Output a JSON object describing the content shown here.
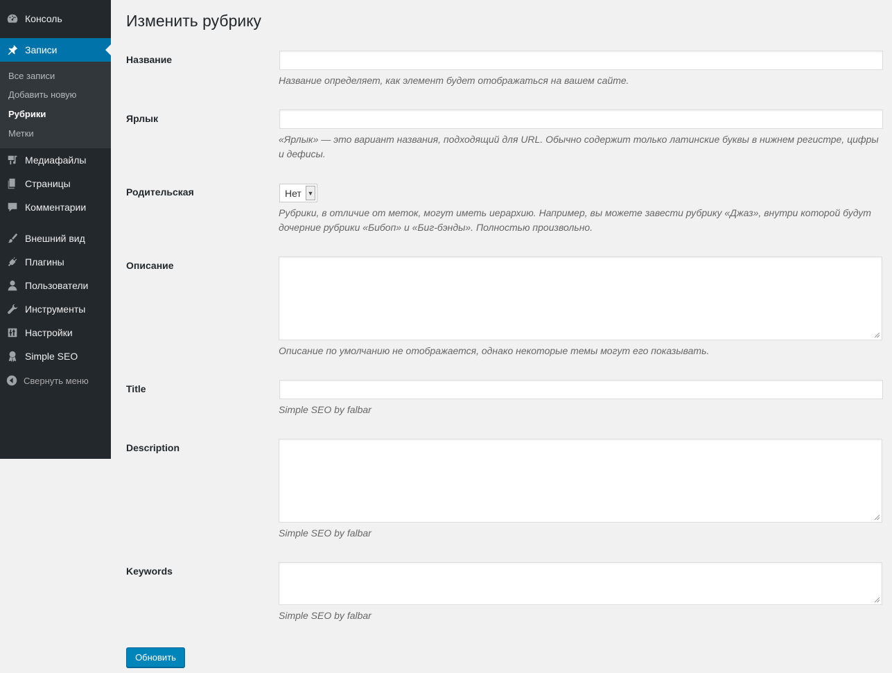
{
  "sidebar": {
    "items": [
      {
        "label": "Консоль",
        "icon": "dashboard-icon"
      },
      {
        "label": "Записи",
        "icon": "pin-icon"
      },
      {
        "label": "Медиафайлы",
        "icon": "media-icon"
      },
      {
        "label": "Страницы",
        "icon": "pages-icon"
      },
      {
        "label": "Комментарии",
        "icon": "comment-icon"
      },
      {
        "label": "Внешний вид",
        "icon": "brush-icon"
      },
      {
        "label": "Плагины",
        "icon": "plugin-icon"
      },
      {
        "label": "Пользователи",
        "icon": "user-icon"
      },
      {
        "label": "Инструменты",
        "icon": "wrench-icon"
      },
      {
        "label": "Настройки",
        "icon": "settings-icon"
      },
      {
        "label": "Simple SEO",
        "icon": "award-icon"
      }
    ],
    "submenu": [
      "Все записи",
      "Добавить новую",
      "Рубрики",
      "Метки"
    ],
    "collapse_label": "Свернуть меню"
  },
  "page": {
    "title": "Изменить рубрику"
  },
  "form": {
    "name_label": "Название",
    "name_help": "Название определяет, как элемент будет отображаться на вашем сайте.",
    "slug_label": "Ярлык",
    "slug_help": "«Ярлык» — это вариант названия, подходящий для URL. Обычно содержит только латинские буквы в нижнем регистре, цифры и дефисы.",
    "parent_label": "Родительская",
    "parent_value": "Нет",
    "parent_help": "Рубрики, в отличие от меток, могут иметь иерархию. Например, вы можете завести рубрику «Джаз», внутри которой будут дочерние рубрики «Бибоп» и «Биг-бэнды». Полностью произвольно.",
    "desc_label": "Описание",
    "desc_help": "Описание по умолчанию не отображается, однако некоторые темы могут его показывать.",
    "seo_title_label": "Title",
    "seo_title_help": "Simple SEO by falbar",
    "seo_desc_label": "Description",
    "seo_desc_help": "Simple SEO by falbar",
    "seo_keywords_label": "Keywords",
    "seo_keywords_help": "Simple SEO by falbar",
    "submit_label": "Обновить"
  },
  "colors": {
    "sidebar_bg": "#23282d",
    "submenu_bg": "#32373c",
    "accent": "#0073aa",
    "button": "#0085ba"
  }
}
